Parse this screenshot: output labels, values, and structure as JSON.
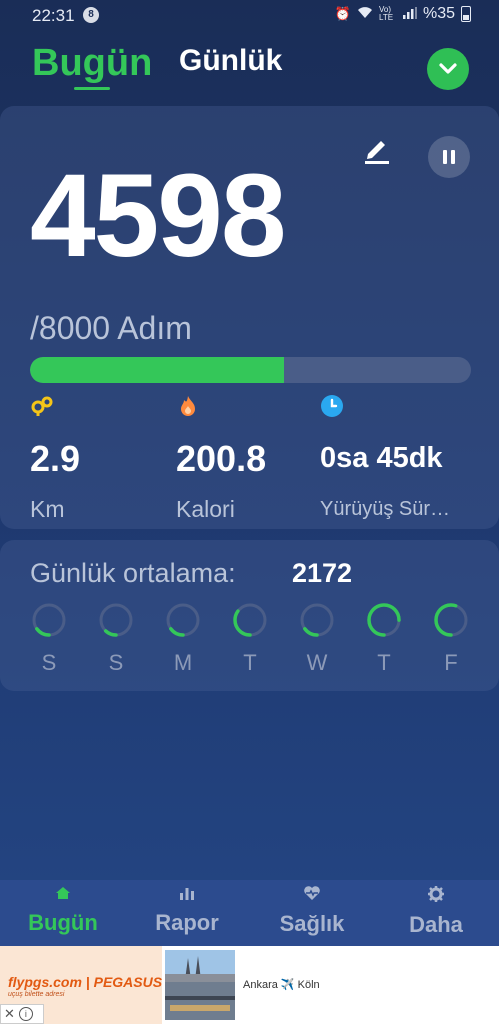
{
  "status_bar": {
    "time": "22:31",
    "notification_count": "8",
    "battery_text": "%35",
    "network_label": "Vo) LTE"
  },
  "header": {
    "tab_today": "Bugün",
    "tab_daily": "Günlük",
    "dropdown_icon": "chevron-down-icon"
  },
  "main": {
    "steps": "4598",
    "goal_text": "/8000 Adım",
    "progress_fraction": 0.575,
    "stats": [
      {
        "icon": "distance-icon",
        "value": "2.9",
        "label": "Km"
      },
      {
        "icon": "flame-icon",
        "value": "200.8",
        "label": "Kalori"
      },
      {
        "icon": "clock-icon",
        "value": "0sa 45dk",
        "label": "Yürüyüş Sür…"
      }
    ]
  },
  "average": {
    "label": "Günlük ortalama:",
    "value": "2172",
    "days": [
      {
        "label": "S",
        "fraction": 0.15
      },
      {
        "label": "S",
        "fraction": 0.12
      },
      {
        "label": "M",
        "fraction": 0.15
      },
      {
        "label": "T",
        "fraction": 0.35
      },
      {
        "label": "W",
        "fraction": 0.15
      },
      {
        "label": "T",
        "fraction": 0.75
      },
      {
        "label": "F",
        "fraction": 0.55
      }
    ]
  },
  "nav": [
    {
      "label": "Bugün",
      "icon": "home-icon",
      "active": true
    },
    {
      "label": "Rapor",
      "icon": "bar-chart-icon",
      "active": false
    },
    {
      "label": "Sağlık",
      "icon": "heart-pulse-icon",
      "active": false
    },
    {
      "label": "Daha",
      "icon": "gear-icon",
      "active": false
    }
  ],
  "ad": {
    "brand": "flypgs.com | PEGASUS",
    "brand_tagline": "uçuş bilette adresi",
    "route": "Ankara ✈️ Köln"
  },
  "colors": {
    "accent": "#34c759",
    "background_top": "#1a2d57",
    "background_bottom": "#254887"
  }
}
